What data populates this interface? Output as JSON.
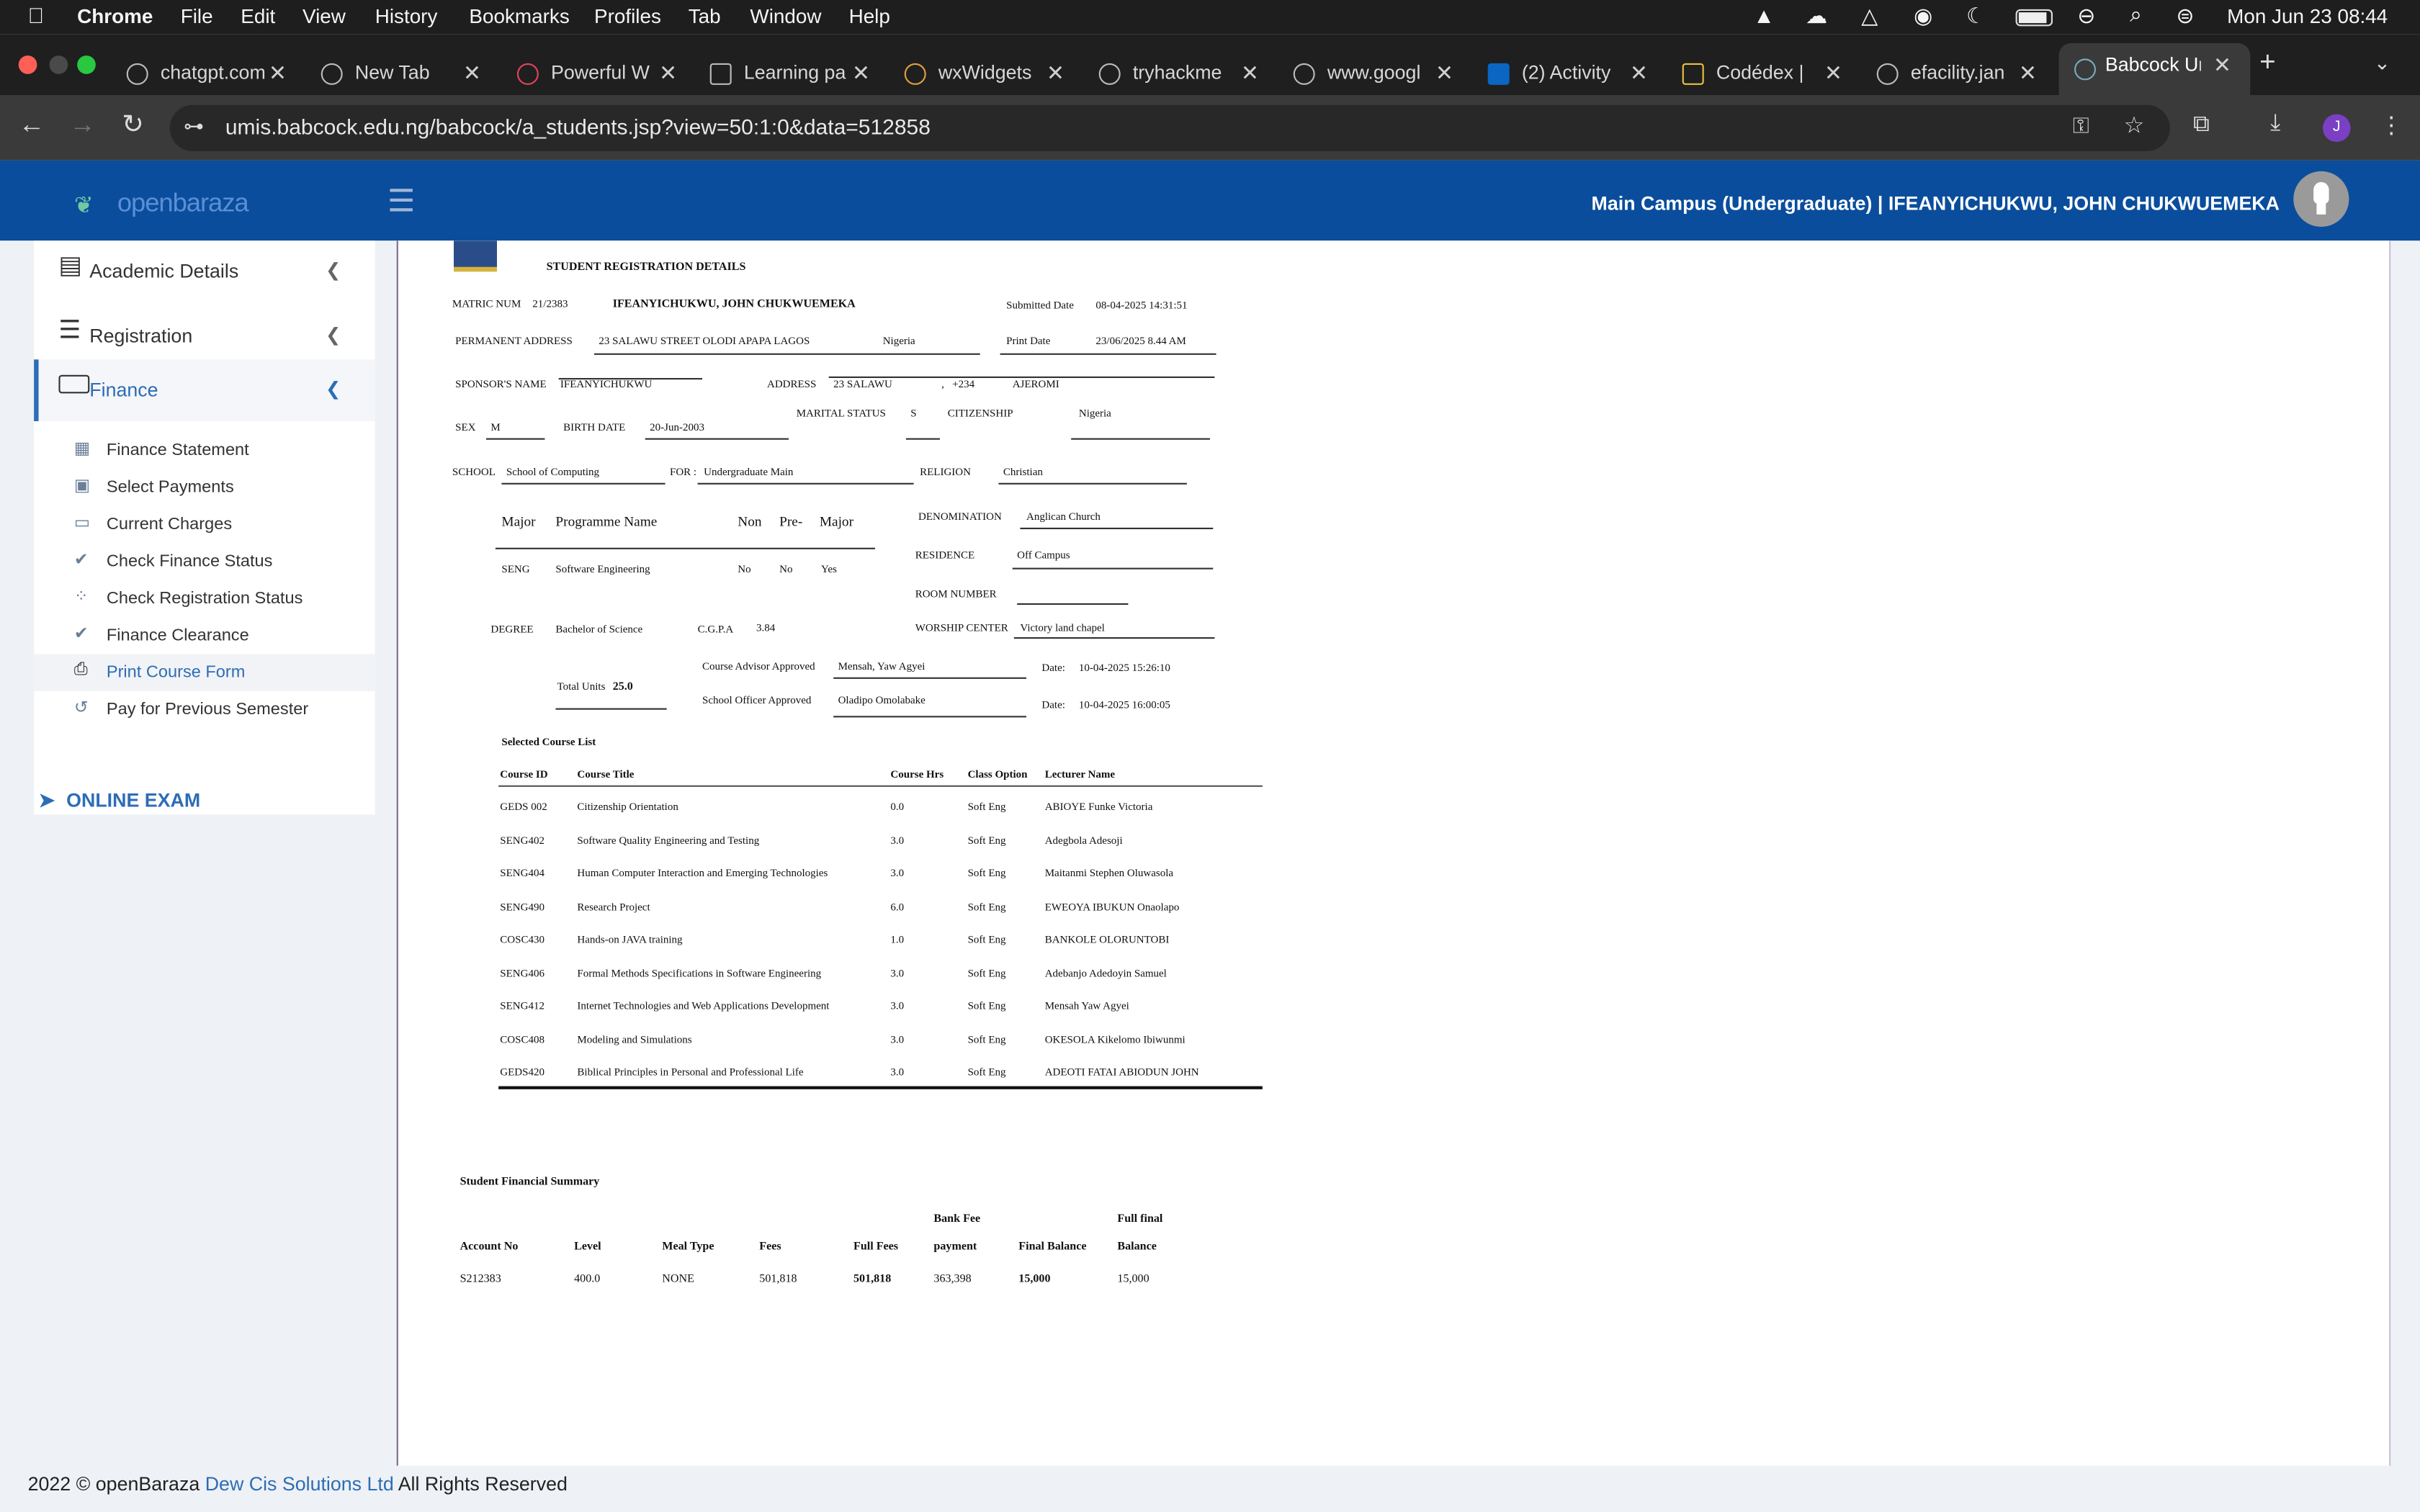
{
  "menubar": {
    "app": "Chrome",
    "items": [
      "File",
      "Edit",
      "View",
      "History",
      "Bookmarks",
      "Profiles",
      "Tab",
      "Window",
      "Help"
    ],
    "clock": "Mon Jun 23  08:44"
  },
  "tabs": [
    "chatgpt.com",
    "New Tab",
    "Powerful W",
    "Learning pa",
    "wxWidgets",
    "tryhackme",
    "www.googl",
    "(2) Activity",
    "Codédex | ",
    "efacility.jan",
    "Babcock Ur"
  ],
  "address": {
    "url": "umis.babcock.edu.ng/babcock/a_students.jsp?view=50:1:0&data=512858",
    "profile_initial": "J"
  },
  "app": {
    "logo": "openbaraza",
    "user": "Main Campus (Undergraduate) | IFEANYICHUKWU, JOHN CHUKWUEMEKA"
  },
  "sidebar": {
    "sections": [
      "Academic Details",
      "Registration",
      "Finance"
    ],
    "finance_items": [
      "Finance Statement",
      "Select Payments",
      "Current Charges",
      "Check Finance Status",
      "Check Registration Status",
      "Finance Clearance",
      "Print Course Form",
      "Pay for Previous Semester"
    ],
    "online_exam": "ONLINE EXAM"
  },
  "doc": {
    "title": "STUDENT REGISTRATION DETAILS",
    "matric_label": "MATRIC NUM",
    "matric": "21/2383",
    "name": "IFEANYICHUKWU, JOHN CHUKWUEMEKA",
    "submitted_label": "Submitted Date",
    "submitted": "08-04-2025 14:31:51",
    "perm_addr_label": "PERMANENT ADDRESS",
    "perm_addr": "23 SALAWU STREET OLODI APAPA LAGOS",
    "perm_country": "Nigeria",
    "print_label": "Print Date",
    "print_date": "23/06/2025 8.44 AM",
    "sponsor_label": "SPONSOR'S NAME",
    "sponsor": "IFEANYICHUKWU",
    "address_label": "ADDRESS",
    "address": "23 SALAWU",
    "address_sep": ",",
    "phone": "+234",
    "area": "AJEROMI",
    "sex_label": "SEX",
    "sex": "M",
    "birth_label": "BIRTH DATE",
    "birth": "20-Jun-2003",
    "marital_label": "MARITAL STATUS",
    "marital": "S",
    "citizenship_label": "CITIZENSHIP",
    "citizenship": "Nigeria",
    "school_label": "SCHOOL",
    "school": "School of Computing",
    "for_label": "FOR :",
    "for": "Undergraduate Main",
    "religion_label": "RELIGION",
    "religion": "Christian",
    "prog_headers": [
      "Major",
      "Programme Name",
      "Non",
      "Pre-",
      "Major"
    ],
    "prog_row": [
      "SENG",
      "Software Engineering",
      "No",
      "No",
      "Yes"
    ],
    "denomination_label": "DENOMINATION",
    "denomination": "Anglican Church",
    "residence_label": "RESIDENCE",
    "residence": "Off Campus",
    "room_label": "ROOM NUMBER",
    "room": "",
    "worship_label": "WORSHIP CENTER",
    "worship": "Victory land chapel",
    "degree_label": "DEGREE",
    "degree": "Bachelor of Science",
    "cgpa_label": "C.G.P.A",
    "cgpa": "3.84",
    "total_units_label": "Total Units",
    "total_units": "25.0",
    "advisor_label": "Course Advisor Approved",
    "advisor": "Mensah, Yaw Agyei",
    "advisor_date_label": "Date:",
    "advisor_date": "10-04-2025 15:26:10",
    "officer_label": "School Officer Approved",
    "officer": "Oladipo Omolabake",
    "officer_date_label": "Date:",
    "officer_date": "10-04-2025 16:00:05",
    "course_list_title": "Selected Course List",
    "course_headers": [
      "Course ID",
      "Course Title",
      "Course Hrs",
      "Class Option",
      "Lecturer Name"
    ],
    "courses": [
      [
        "GEDS 002",
        "Citizenship Orientation",
        "0.0",
        "Soft Eng",
        "ABIOYE  Funke Victoria"
      ],
      [
        "SENG402",
        "Software Quality Engineering and Testing",
        "3.0",
        "Soft Eng",
        "Adegbola  Adesoji"
      ],
      [
        "SENG404",
        "Human Computer Interaction and Emerging Technologies",
        "3.0",
        "Soft Eng",
        "Maitanmi  Stephen Oluwasola"
      ],
      [
        "SENG490",
        "Research Project",
        "6.0",
        "Soft Eng",
        "EWEOYA  IBUKUN Onaolapo"
      ],
      [
        "COSC430",
        "Hands-on JAVA training",
        "1.0",
        "Soft Eng",
        "BANKOLE  OLORUNTOBI"
      ],
      [
        "SENG406",
        "Formal Methods Specifications in Software Engineering",
        "3.0",
        "Soft Eng",
        "Adebanjo  Adedoyin Samuel"
      ],
      [
        "SENG412",
        "Internet Technologies and Web Applications Development",
        "3.0",
        "Soft Eng",
        "Mensah  Yaw Agyei"
      ],
      [
        "COSC408",
        "Modeling and Simulations",
        "3.0",
        "Soft Eng",
        "OKESOLA  Kikelomo Ibiwunmi"
      ],
      [
        "GEDS420",
        "Biblical Principles in Personal and Professional Life",
        "3.0",
        "Soft Eng",
        "ADEOTI  FATAI ABIODUN JOHN"
      ]
    ],
    "fin_title": "Student Financial Summary",
    "fin_headers_top": [
      "",
      "",
      "",
      "",
      "",
      "Bank Fee",
      "",
      "Full final"
    ],
    "fin_headers": [
      "Account No",
      "Level",
      "Meal Type",
      "Fees",
      "Full Fees",
      "payment",
      "Final Balance",
      "Balance"
    ],
    "fin_row": [
      "S212383",
      "400.0",
      "NONE",
      "501,818",
      "501,818",
      "363,398",
      "15,000",
      "15,000"
    ]
  },
  "footer": {
    "prefix": "2022 © openBaraza ",
    "link": "Dew Cis Solutions Ltd",
    "suffix": " All Rights Reserved"
  },
  "colors": {
    "appbar": "#0a4d9c",
    "link": "#2d6db5",
    "active_border": "#2d6db5"
  }
}
